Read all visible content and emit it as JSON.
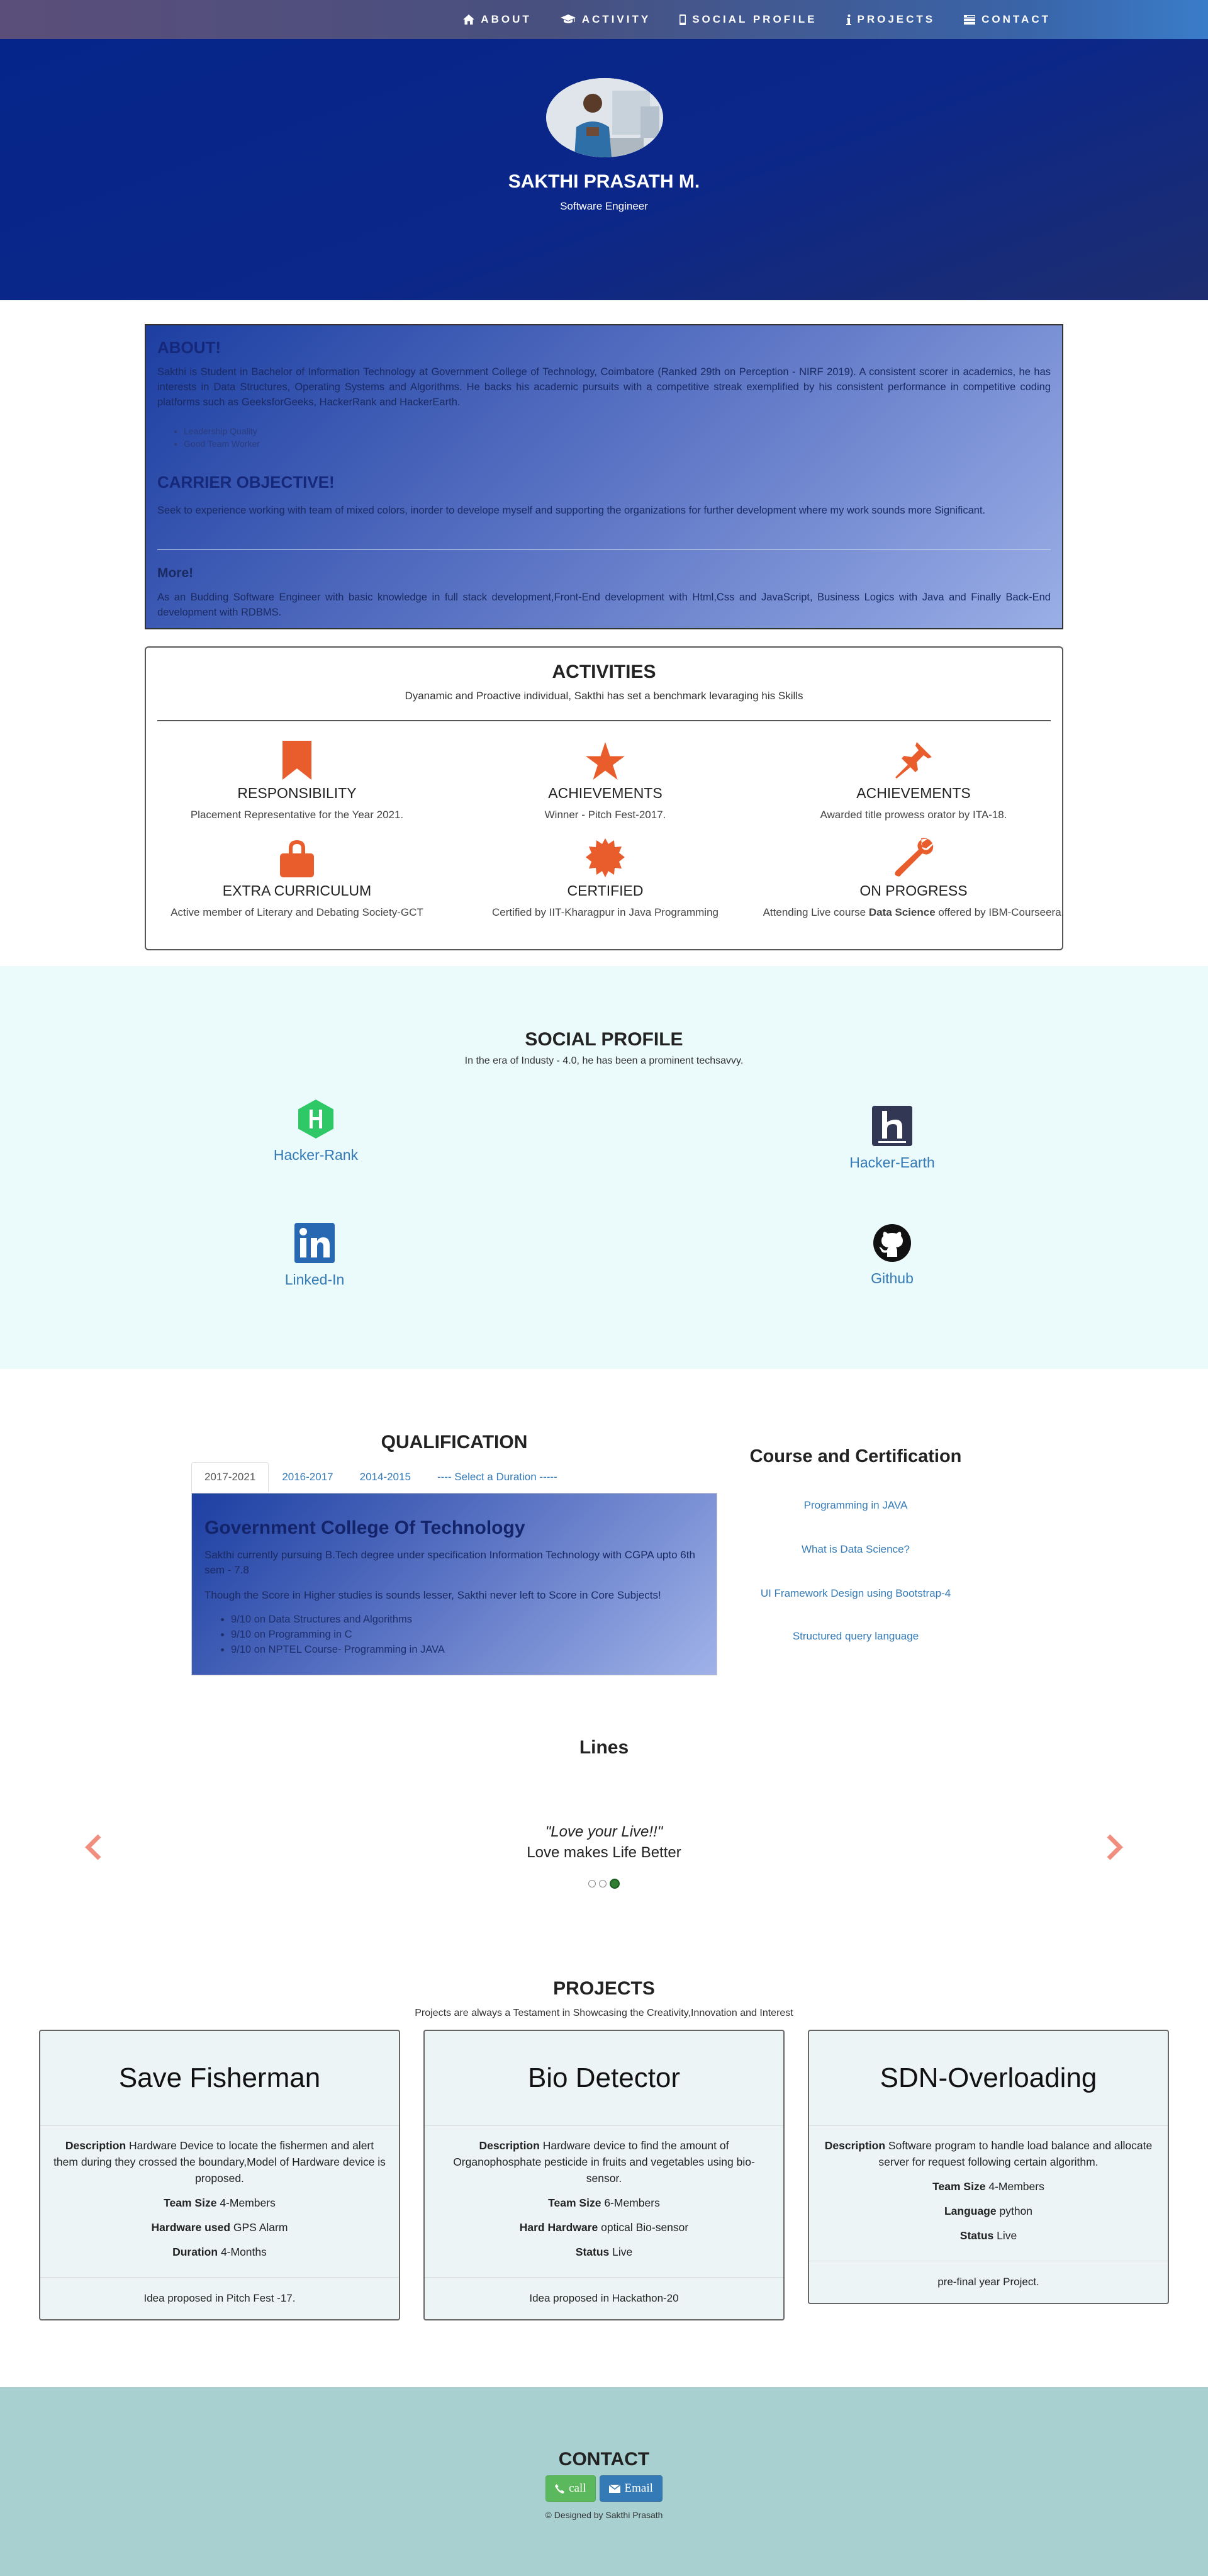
{
  "nav": {
    "items": [
      {
        "label": "ABOUT",
        "icon": "home-icon"
      },
      {
        "label": "ACTIVITY",
        "icon": "graduation-cap-icon"
      },
      {
        "label": "SOCIAL PROFILE",
        "icon": "mobile-icon"
      },
      {
        "label": "PROJECTS",
        "icon": "info-icon"
      },
      {
        "label": "CONTACT",
        "icon": "list-icon"
      }
    ]
  },
  "hero": {
    "name": "SAKTHI PRASATH M.",
    "role": "Software Engineer"
  },
  "about": {
    "title": "ABOUT!",
    "text": "Sakthi is Student in Bachelor of Information Technology at Government College of Technology, Coimbatore (Ranked 29th on Perception - NIRF 2019). A consistent scorer in academics, he has interests in Data Structures, Operating Systems and Algorithms. He backs his academic pursuits with a competitive streak exemplified by his consistent performance in competitive coding platforms such as GeeksforGeeks, HackerRank and HackerEarth.",
    "list": [
      "Leadership Quality",
      "Good Team Worker"
    ],
    "objective_title": "CARRIER OBJECTIVE!",
    "objective_text": "Seek to experience working with team of mixed colors, inorder to develope myself and supporting the organizations for further development where my work sounds more Significant.",
    "more_title": "More!",
    "more_text": "As an Budding Software Engineer with basic knowledge in full stack development,Front-End development with Html,Css and JavaScript, Business Logics with Java and Finally Back-End development with RDBMS."
  },
  "activities": {
    "title": "ACTIVITIES",
    "subtitle": "Dyanamic and Proactive individual, Sakthi has set a benchmark levaraging his Skills",
    "items": [
      {
        "title": "RESPONSIBILITY",
        "desc": "Placement Representative for the Year 2021.",
        "icon": "bookmark-icon"
      },
      {
        "title": "ACHIEVEMENTS",
        "desc": "Winner - Pitch Fest-2017.",
        "icon": "star-icon"
      },
      {
        "title": "ACHIEVEMENTS",
        "desc": "Awarded title prowess orator by ITA-18.",
        "icon": "pushpin-icon"
      },
      {
        "title": "EXTRA CURRICULUM",
        "desc": "Active member of Literary and Debating Society-GCT",
        "icon": "lock-icon"
      },
      {
        "title": "CERTIFIED",
        "desc": "Certified by IIT-Kharagpur in Java Programming",
        "icon": "certificate-icon"
      },
      {
        "title": "ON PROGRESS",
        "desc_pre": "Attending Live course ",
        "desc_bold": "Data Science",
        "desc_post": " offered by IBM-Courseera.",
        "icon": "wrench-icon"
      }
    ],
    "icon_color": "#e95d2c"
  },
  "social": {
    "title": "SOCIAL PROFILE",
    "subtitle": "In the era of Industy - 4.0, he has been a prominent techsavvy.",
    "items": [
      {
        "label": "Hacker-Rank",
        "icon": "hackerrank-icon"
      },
      {
        "label": "Hacker-Earth",
        "icon": "hackerearth-icon"
      },
      {
        "label": "Linked-In",
        "icon": "linkedin-icon"
      },
      {
        "label": "Github",
        "icon": "github-icon"
      }
    ]
  },
  "qualification": {
    "title": "QUALIFICATION",
    "tabs": [
      "2017-2021",
      "2016-2017",
      "2014-2015",
      "---- Select a Duration -----"
    ],
    "active_tab": "2017-2021",
    "college": "Government College Of Technology",
    "text1": "Sakthi currently pursuing B.Tech degree under specification Information Technology with CGPA upto 6th sem - 7.8",
    "text2": "Though the Score in Higher studies is sounds lesser, Sakthi never left to Score in Core Subjects!",
    "list": [
      "9/10 on Data Structures and Algorithms",
      "9/10 on Programming in C",
      "9/10 on NPTEL Course- Programming in JAVA"
    ]
  },
  "courses": {
    "title": "Course and Certification",
    "links": [
      "Programming in JAVA",
      "What is Data Science?",
      "UI Framework Design using Bootstrap-4",
      "Structured query language"
    ]
  },
  "lines": {
    "title": "Lines",
    "quote": "\"Love your Live!!\"",
    "quote_sub": "Love makes Life Better"
  },
  "projects": {
    "title": "PROJECTS",
    "subtitle": "Projects are always a Testament in Showcasing the Creativity,Innovation and Interest",
    "items": [
      {
        "title": "Save Fisherman",
        "description": "Hardware Device to locate the fishermen and alert them during they crossed the boundary,Model of Hardware device is proposed.",
        "team_size": "4-Members",
        "k3": "Hardware used",
        "v3": "GPS Alarm",
        "k4": "Duration",
        "v4": "4-Months",
        "footer": "Idea proposed in Pitch Fest -17."
      },
      {
        "title": "Bio Detector",
        "description": "Hardware device to find the amount of Organophosphate pesticide in fruits and vegetables using bio-sensor.",
        "team_size": "6-Members",
        "k3": "Hard Hardware",
        "v3": "optical Bio-sensor",
        "k4": "Status",
        "v4": "Live",
        "footer": "Idea proposed in Hackathon-20"
      },
      {
        "title": "SDN-Overloading",
        "description": "Software program to handle load balance and allocate server for request following certain algorithm.",
        "team_size": "4-Members",
        "k3": "Language",
        "v3": "python",
        "k4": "Status",
        "v4": "Live",
        "footer": "pre-final year Project."
      }
    ],
    "labels": {
      "description": "Description",
      "team_size": "Team Size"
    }
  },
  "contact": {
    "title": "CONTACT",
    "call_label": "call",
    "email_label": "Email",
    "footer": "© Designed by Sakthi Prasath"
  }
}
